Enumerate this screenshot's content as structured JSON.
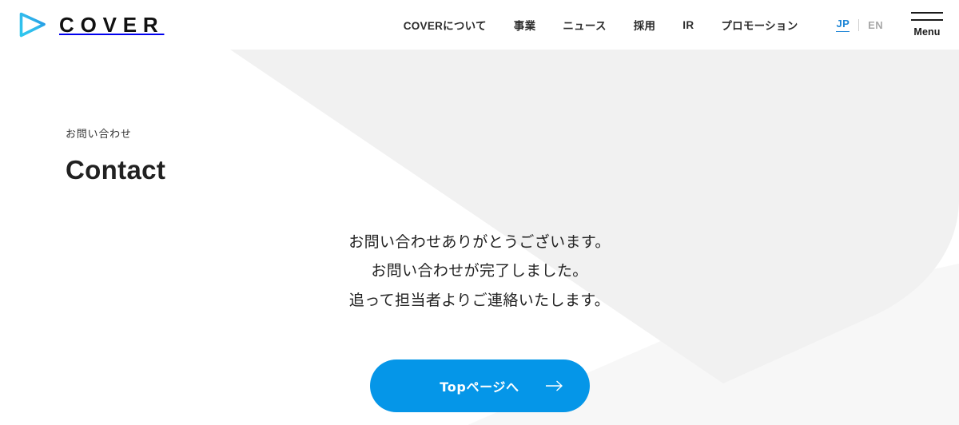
{
  "header": {
    "logo": {
      "icon": "play-triangle-logo-icon",
      "wordmark": "COVER",
      "gradient_from": "#3fd0f0",
      "gradient_to": "#1b8fe0"
    },
    "nav_items": [
      {
        "label": "COVERについて"
      },
      {
        "label": "事業"
      },
      {
        "label": "ニュース"
      },
      {
        "label": "採用"
      },
      {
        "label": "IR"
      },
      {
        "label": "プロモーション"
      }
    ],
    "language": {
      "active": "JP",
      "inactive": "EN",
      "active_color": "#1d85d6",
      "inactive_color": "#a8a8a8"
    },
    "menu": {
      "icon": "hamburger-menu-icon",
      "label": "Menu"
    }
  },
  "page": {
    "eyebrow": "お問い合わせ",
    "title": "Contact"
  },
  "main": {
    "message_lines": [
      "お問い合わせありがとうございます。",
      "お問い合わせが完了しました。",
      "追って担当者よりご連絡いたします。"
    ],
    "cta": {
      "label": "Topページへ",
      "icon": "arrow-right-icon",
      "background_color": "#0596e8",
      "text_color": "#ffffff"
    }
  },
  "decor": {
    "shape_gray": "#f1f1f1",
    "shape_light_gray": "#f7f7f7",
    "background": "#ffffff"
  }
}
